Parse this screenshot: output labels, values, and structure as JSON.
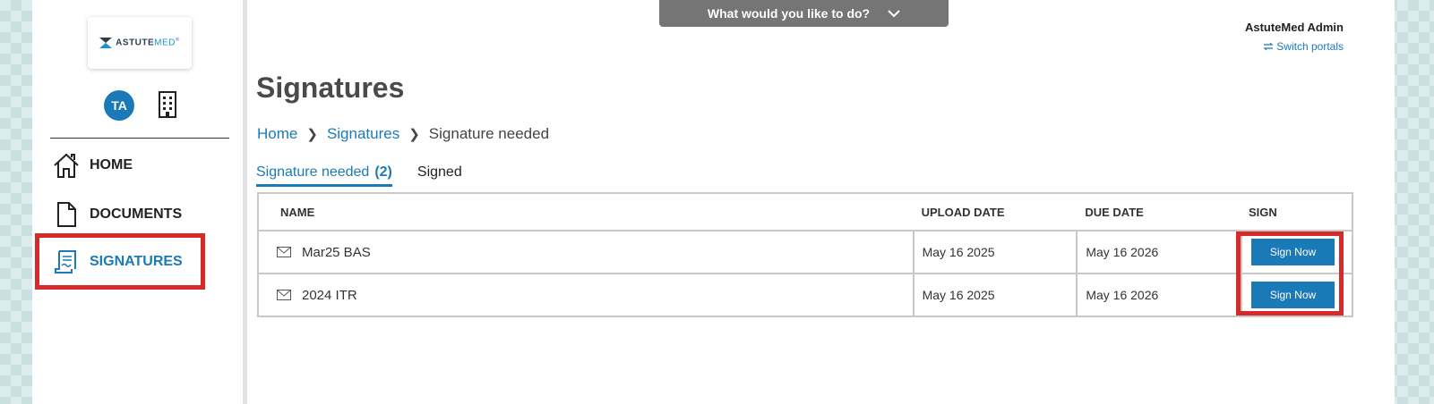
{
  "header": {
    "action_menu_label": "What would you like to do?",
    "portal_name": "AstuteMed Admin",
    "switch_portals_label": "Switch portals"
  },
  "sidebar": {
    "logo_text_main": "ASTUTE",
    "logo_text_accent": "MED",
    "avatar_initials": "TA",
    "items": [
      {
        "label": "HOME",
        "icon": "home-icon"
      },
      {
        "label": "DOCUMENTS",
        "icon": "document-icon"
      },
      {
        "label": "SIGNATURES",
        "icon": "signature-icon",
        "active": true
      }
    ]
  },
  "main": {
    "title": "Signatures",
    "breadcrumb": [
      "Home",
      "Signatures",
      "Signature needed"
    ],
    "tabs": [
      {
        "label": "Signature needed",
        "count": "(2)",
        "active": true
      },
      {
        "label": "Signed",
        "active": false
      }
    ],
    "table": {
      "columns": [
        "NAME",
        "UPLOAD DATE",
        "DUE DATE",
        "SIGN"
      ],
      "rows": [
        {
          "name": "Mar25 BAS",
          "upload_date": "May 16 2025",
          "due_date": "May 16 2026",
          "action": "Sign Now"
        },
        {
          "name": "2024 ITR",
          "upload_date": "May 16 2025",
          "due_date": "May 16 2026",
          "action": "Sign Now"
        }
      ]
    }
  },
  "colors": {
    "accent": "#1a7ab8",
    "highlight": "#d62a2a",
    "action_bar": "#757575"
  }
}
